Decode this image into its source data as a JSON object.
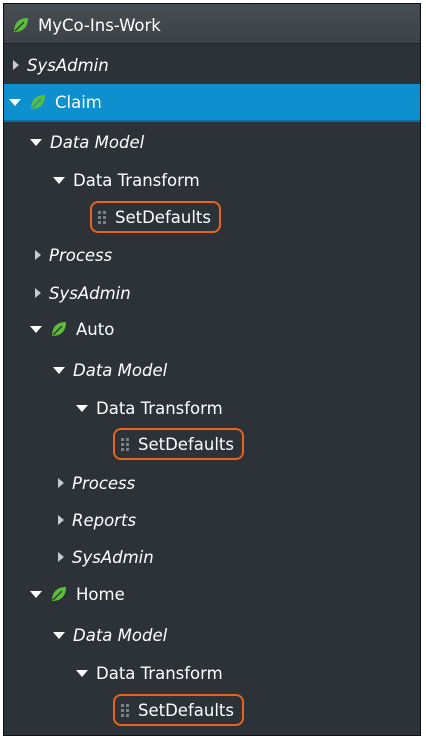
{
  "tree": {
    "root": {
      "label": "MyCo-Ins-Work",
      "icon": "leaf-icon"
    },
    "nodes": [
      {
        "label": "SysAdmin",
        "italic": true,
        "expanded": false
      },
      {
        "label": "Claim",
        "selected": true,
        "expanded": true,
        "icon": "leaf-icon"
      },
      {
        "label": "Data Model",
        "italic": true,
        "expanded": true
      },
      {
        "label": "Data Transform",
        "expanded": true
      },
      {
        "label": "SetDefaults",
        "highlighted": true
      },
      {
        "label": "Process",
        "italic": true,
        "expanded": false
      },
      {
        "label": "SysAdmin",
        "italic": true,
        "expanded": false
      },
      {
        "label": "Auto",
        "expanded": true,
        "icon": "leaf-icon"
      },
      {
        "label": "Data Model",
        "italic": true,
        "expanded": true
      },
      {
        "label": "Data Transform",
        "expanded": true
      },
      {
        "label": "SetDefaults",
        "highlighted": true
      },
      {
        "label": "Process",
        "italic": true,
        "expanded": false
      },
      {
        "label": "Reports",
        "italic": true,
        "expanded": false
      },
      {
        "label": "SysAdmin",
        "italic": true,
        "expanded": false
      },
      {
        "label": "Home",
        "expanded": true,
        "icon": "leaf-icon"
      },
      {
        "label": "Data Model",
        "italic": true,
        "expanded": true
      },
      {
        "label": "Data Transform",
        "expanded": true
      },
      {
        "label": "SetDefaults",
        "highlighted": true
      }
    ]
  },
  "colors": {
    "panel_bg": "#2c3238",
    "selected_bg": "#0e8fce",
    "highlight_border": "#e8641b",
    "leaf_icon": "#5cbf3a"
  }
}
